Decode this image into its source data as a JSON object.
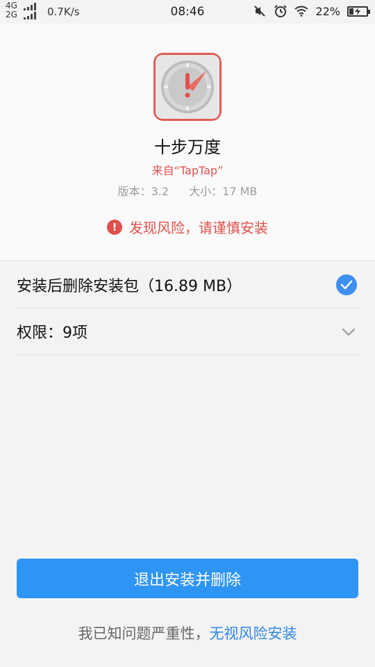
{
  "statusbar": {
    "net_top": "4G",
    "net_bottom": "2G",
    "speed": "0.7K/s",
    "time": "08:46",
    "battery": "22%",
    "icons": [
      "mute-icon",
      "alarm-icon",
      "wifi-icon",
      "battery-charging-icon"
    ]
  },
  "app": {
    "name": "十步万度",
    "source": "来自“TapTap”",
    "version": "版本：3.2",
    "size": "大小：17 MB",
    "icon": "compass-warning-icon",
    "accent": "#e25a52"
  },
  "risk": {
    "text": "发现风险，请谨慎安装",
    "icon": "!",
    "color": "#e0504c"
  },
  "options": {
    "delete_pkg": "安装后删除安装包（16.89 MB）",
    "permissions": "权限：9项"
  },
  "actions": {
    "primary": "退出安装并删除",
    "primary_color": "#2f95f4",
    "footer_prefix": "我已知问题严重性，",
    "footer_link": "无视风险安装"
  }
}
